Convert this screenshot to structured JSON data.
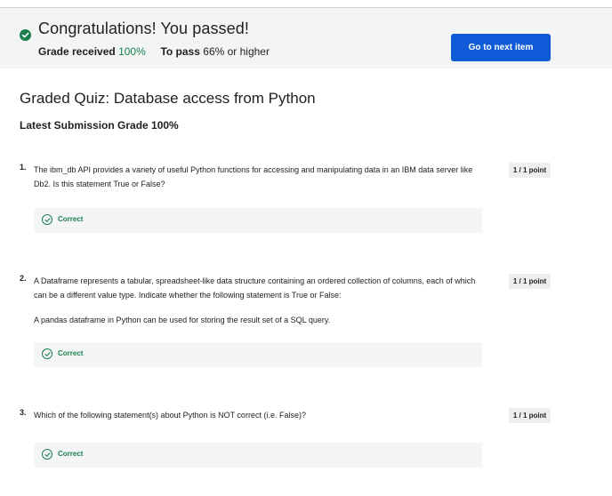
{
  "banner": {
    "title": "Congratulations! You passed!",
    "grade_label": "Grade received",
    "grade_value": "100%",
    "pass_label": "To pass",
    "pass_value": "66% or higher",
    "next_button": "Go to next item"
  },
  "quiz": {
    "title": "Graded Quiz: Database access from Python",
    "latest_grade": "Latest Submission Grade 100%"
  },
  "questions": [
    {
      "number": "1.",
      "text": "The ibm_db API provides a variety of useful Python functions for accessing and manipulating data in an IBM data server like Db2. Is this statement True or False?",
      "extra": "",
      "points": "1 / 1 point",
      "feedback": "Correct"
    },
    {
      "number": "2.",
      "text": "A Dataframe represents a tabular, spreadsheet-like data structure containing an ordered collection of columns, each of which can be a different value type. Indicate whether the following statement is True or False:",
      "extra": "A pandas dataframe in Python can be used for storing the result set of a SQL query.",
      "points": "1 / 1 point",
      "feedback": "Correct"
    },
    {
      "number": "3.",
      "text": "Which of the following statement(s) about Python is NOT correct (i.e. False)?",
      "extra": "",
      "points": "1 / 1 point",
      "feedback": "Correct"
    }
  ],
  "colors": {
    "accent": "#0f5ad6",
    "success": "#1b7f4d",
    "banner_bg": "#f3f5f4"
  }
}
